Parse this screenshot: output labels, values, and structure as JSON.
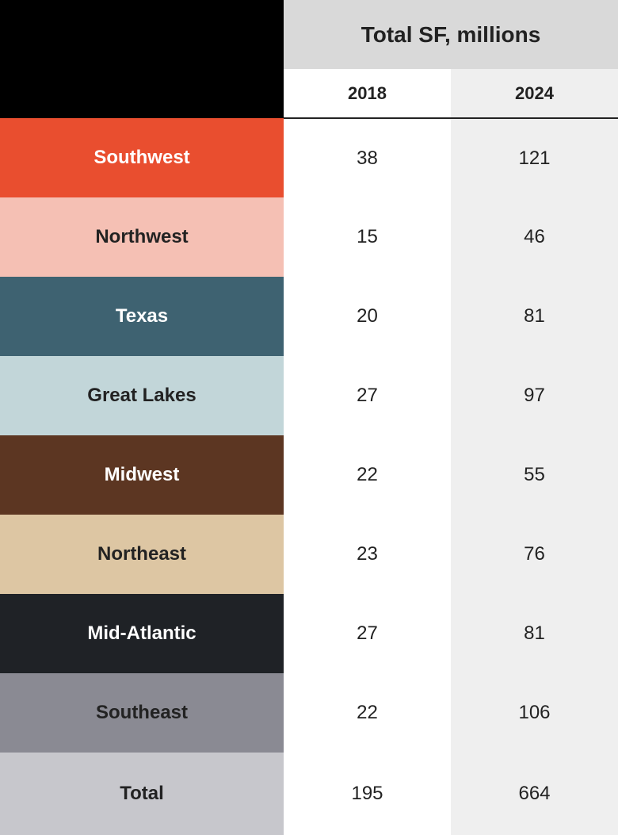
{
  "header": {
    "group_label": "Total SF, millions",
    "year1": "2018",
    "year2": "2024"
  },
  "rows": [
    {
      "key": "southwest",
      "label": "Southwest",
      "v2018": "38",
      "v2024": "121",
      "cls": "rc-southwest"
    },
    {
      "key": "northwest",
      "label": "Northwest",
      "v2018": "15",
      "v2024": "46",
      "cls": "rc-northwest"
    },
    {
      "key": "texas",
      "label": "Texas",
      "v2018": "20",
      "v2024": "81",
      "cls": "rc-texas"
    },
    {
      "key": "greatlakes",
      "label": "Great Lakes",
      "v2018": "27",
      "v2024": "97",
      "cls": "rc-greatlakes"
    },
    {
      "key": "midwest",
      "label": "Midwest",
      "v2018": "22",
      "v2024": "55",
      "cls": "rc-midwest"
    },
    {
      "key": "northeast",
      "label": "Northeast",
      "v2018": "23",
      "v2024": "76",
      "cls": "rc-northeast"
    },
    {
      "key": "midatlantic",
      "label": "Mid-Atlantic",
      "v2018": "27",
      "v2024": "81",
      "cls": "rc-midatlantic"
    },
    {
      "key": "southeast",
      "label": "Southeast",
      "v2018": "22",
      "v2024": "106",
      "cls": "rc-southeast"
    },
    {
      "key": "total",
      "label": "Total",
      "v2018": "195",
      "v2024": "664",
      "cls": "rc-total"
    }
  ],
  "chart_data": {
    "type": "table",
    "title": "Total SF, millions",
    "categories": [
      "Southwest",
      "Northwest",
      "Texas",
      "Great Lakes",
      "Midwest",
      "Northeast",
      "Mid-Atlantic",
      "Southeast",
      "Total"
    ],
    "series": [
      {
        "name": "2018",
        "values": [
          38,
          15,
          20,
          27,
          22,
          23,
          27,
          22,
          195
        ]
      },
      {
        "name": "2024",
        "values": [
          121,
          46,
          81,
          97,
          55,
          76,
          81,
          106,
          664
        ]
      }
    ],
    "xlabel": "",
    "ylabel": "Total SF, millions",
    "region_colors": {
      "Southwest": "#e94e2f",
      "Northwest": "#f5c0b4",
      "Texas": "#3e6271",
      "Great Lakes": "#c2d6d9",
      "Midwest": "#5c3622",
      "Northeast": "#ddc6a3",
      "Mid-Atlantic": "#1f2226",
      "Southeast": "#8a8a93",
      "Total": "#c7c7cc"
    }
  }
}
